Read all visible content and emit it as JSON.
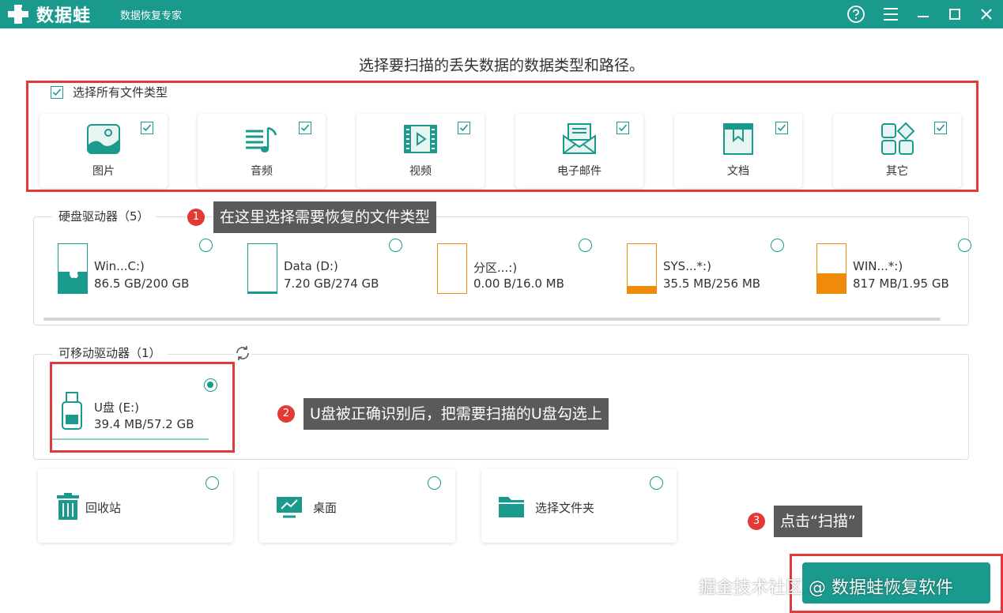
{
  "titlebar": {
    "logo": "数据蛙",
    "subtitle": "数据恢复专家",
    "icons": [
      "help-icon",
      "menu-icon",
      "minimize-icon",
      "maximize-icon",
      "close-icon"
    ]
  },
  "heading": "选择要扫描的丢失数据的数据类型和路径。",
  "file_types": {
    "select_all_label": "选择所有文件类型",
    "items": [
      {
        "label": "图片",
        "icon": "image-icon"
      },
      {
        "label": "音频",
        "icon": "audio-icon"
      },
      {
        "label": "视频",
        "icon": "video-icon"
      },
      {
        "label": "电子邮件",
        "icon": "email-icon"
      },
      {
        "label": "文档",
        "icon": "document-icon"
      },
      {
        "label": "其它",
        "icon": "other-icon"
      }
    ]
  },
  "hard_drives": {
    "label": "硬盘驱动器（5）",
    "items": [
      {
        "name": "Win...C:)",
        "size": "86.5 GB/200 GB"
      },
      {
        "name": "Data (D:)",
        "size": "7.20 GB/274 GB"
      },
      {
        "name": "分区...:)",
        "size": "0.00  B/16.0 MB"
      },
      {
        "name": "SYS...*:)",
        "size": "35.5 MB/256 MB"
      },
      {
        "name": "WIN...*:)",
        "size": "817 MB/1.95 GB"
      }
    ]
  },
  "removable": {
    "label": "可移动驱动器（1）",
    "items": [
      {
        "name": "U盘 (E:)",
        "size": "39.4 MB/57.2 GB"
      }
    ]
  },
  "locations": [
    {
      "label": "回收站",
      "icon": "recycle-bin-icon"
    },
    {
      "label": "桌面",
      "icon": "desktop-icon"
    },
    {
      "label": "选择文件夹",
      "icon": "folder-icon"
    }
  ],
  "callouts": [
    {
      "num": "1",
      "text": "在这里选择需要恢复的文件类型"
    },
    {
      "num": "2",
      "text": "U盘被正确识别后，把需要扫描的U盘勾选上"
    },
    {
      "num": "3",
      "text": "点击“扫描”"
    }
  ],
  "watermark": "掘金技术社区 @ 数据蛙恢复软件",
  "colors": {
    "accent": "#1a9a8c",
    "highlight": "#e23a3a",
    "orange": "#f08a0a"
  }
}
